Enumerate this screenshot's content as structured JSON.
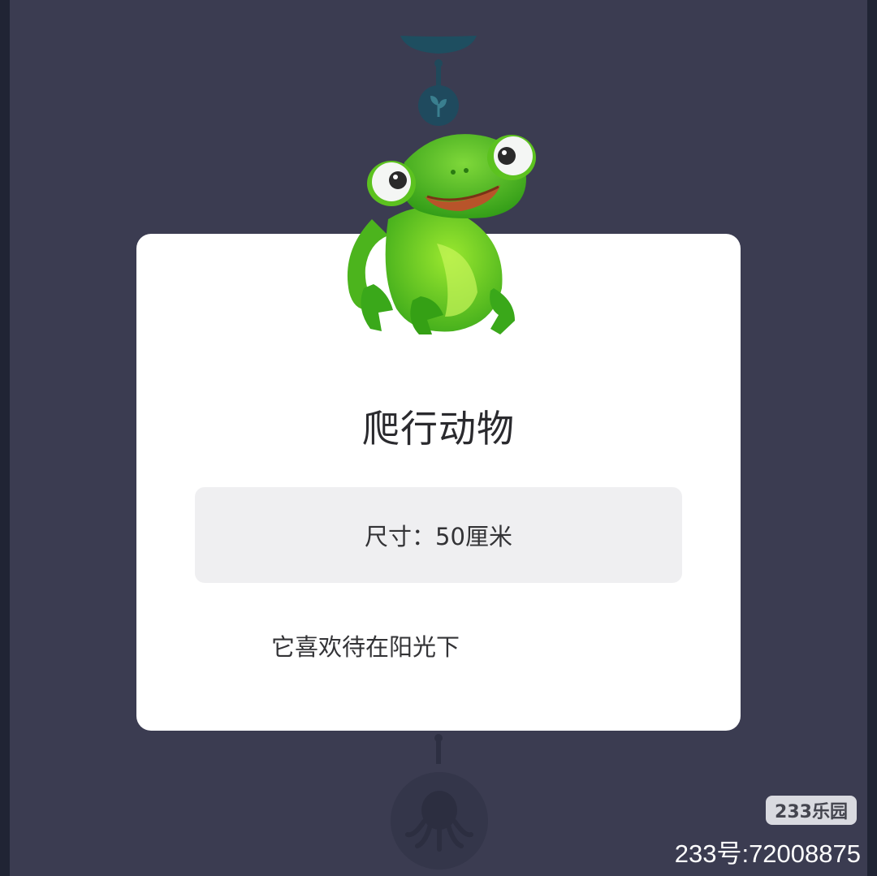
{
  "card": {
    "title": "爬行动物",
    "size_text": "尺寸：50厘米",
    "description": "它喜欢待在阳光下"
  },
  "watermark": {
    "badge": "233乐园",
    "id_text": "233号:72008875"
  },
  "icons": {
    "top_node": "sprout-icon",
    "bottom_node": "octopus-icon",
    "creature": "reptile-lizard-icon"
  },
  "colors": {
    "background": "#3b3c51",
    "card": "#ffffff",
    "size_box": "#efeff1",
    "node_teal": "#1f4a5e",
    "lizard_green": "#4fc11f"
  }
}
